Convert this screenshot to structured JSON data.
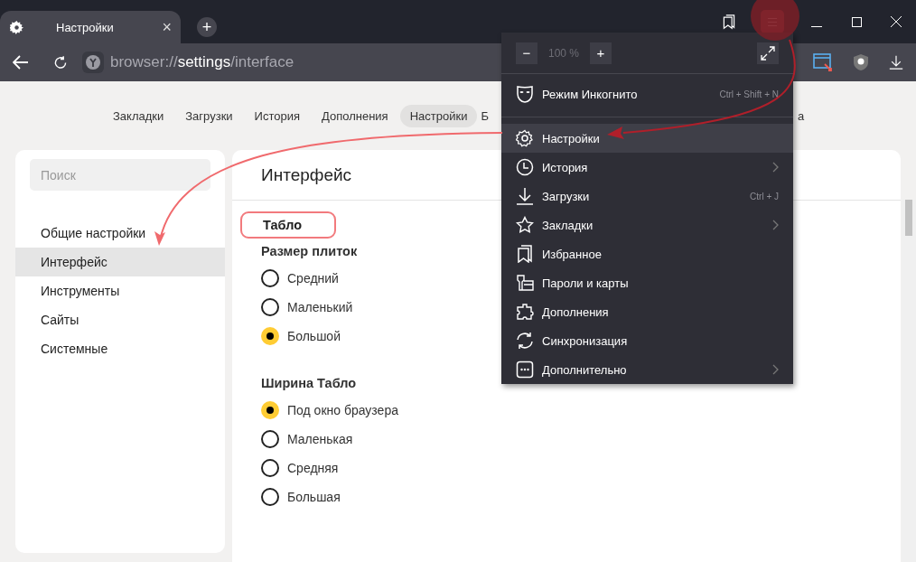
{
  "browser_tab": {
    "title": "Настройки",
    "close": "×",
    "new_tab": "+"
  },
  "address": {
    "scheme": "browser://",
    "host": "settings",
    "path": "/interface"
  },
  "nav_tabs": [
    {
      "label": "Закладки",
      "selected": false
    },
    {
      "label": "Загрузки",
      "selected": false
    },
    {
      "label": "История",
      "selected": false
    },
    {
      "label": "Дополнения",
      "selected": false
    },
    {
      "label": "Настройки",
      "selected": true
    },
    {
      "label": "Б",
      "selected": false
    }
  ],
  "nav_tail": "а",
  "sidebar": {
    "search": {
      "placeholder": "Поиск"
    },
    "items": [
      {
        "label": "Общие настройки",
        "selected": false
      },
      {
        "label": "Интерфейс",
        "selected": true
      },
      {
        "label": "Инструменты",
        "selected": false
      },
      {
        "label": "Сайты",
        "selected": false
      },
      {
        "label": "Системные",
        "selected": false
      }
    ]
  },
  "page": {
    "title": "Интерфейс",
    "section": "Табло",
    "groups": [
      {
        "label": "Размер плиток",
        "options": [
          {
            "label": "Средний",
            "selected": false
          },
          {
            "label": "Маленький",
            "selected": false
          },
          {
            "label": "Большой",
            "selected": true
          }
        ]
      },
      {
        "label": "Ширина Табло",
        "options": [
          {
            "label": "Под окно браузера",
            "selected": true
          },
          {
            "label": "Маленькая",
            "selected": false
          },
          {
            "label": "Средняя",
            "selected": false
          },
          {
            "label": "Большая",
            "selected": false
          }
        ]
      }
    ]
  },
  "menu": {
    "zoom": {
      "minus": "−",
      "value": "100 %",
      "plus": "+"
    },
    "incognito": {
      "label": "Режим Инкогнито",
      "shortcut": "Ctrl + Shift + N"
    },
    "items": [
      {
        "label": "Настройки",
        "selected": true,
        "submenu": false
      },
      {
        "label": "История",
        "selected": false,
        "submenu": true
      },
      {
        "label": "Загрузки",
        "selected": false,
        "submenu": false,
        "shortcut": "Ctrl + J"
      },
      {
        "label": "Закладки",
        "selected": false,
        "submenu": true
      },
      {
        "label": "Избранное",
        "selected": false,
        "submenu": false
      },
      {
        "label": "Пароли и карты",
        "selected": false,
        "submenu": false
      },
      {
        "label": "Дополнения",
        "selected": false,
        "submenu": false
      },
      {
        "label": "Синхронизация",
        "selected": false,
        "submenu": false
      },
      {
        "label": "Дополнительно",
        "selected": false,
        "submenu": true
      }
    ]
  }
}
